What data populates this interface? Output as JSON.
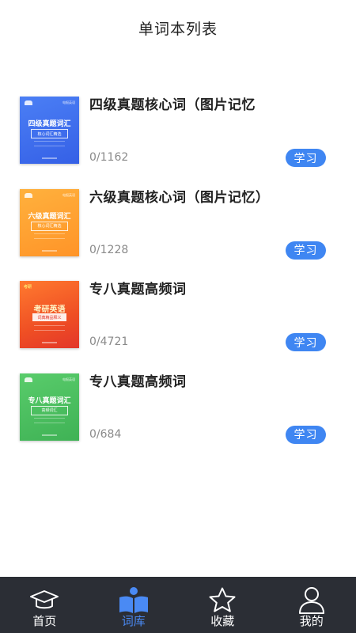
{
  "header": {
    "title": "单词本列表"
  },
  "books": [
    {
      "name": "四级真题核心词（图片记忆",
      "count": "0/1162",
      "action": "学习",
      "cover": {
        "theme": "blue",
        "brand": "电报英语",
        "title": "四级真题词汇",
        "subtitle": "核心词汇精选"
      }
    },
    {
      "name": "六级真题核心词（图片记忆）",
      "count": "0/1228",
      "action": "学习",
      "cover": {
        "theme": "orange",
        "brand": "电报英语",
        "title": "六级真题词汇",
        "subtitle": "核心词汇精选"
      }
    },
    {
      "name": "专八真题高频词",
      "count": "0/4721",
      "action": "学习",
      "cover": {
        "theme": "red",
        "brand": "考研",
        "title": "考研英语",
        "subtitle": "词典精品释义"
      }
    },
    {
      "name": "专八真题高频词",
      "count": "0/684",
      "action": "学习",
      "cover": {
        "theme": "green",
        "brand": "电报英语",
        "title": "专八真题词汇",
        "subtitle": "高频词汇"
      }
    }
  ],
  "tabs": [
    {
      "label": "首页",
      "icon": "graduation-cap-icon",
      "active": false
    },
    {
      "label": "词库",
      "icon": "open-book-icon",
      "active": true
    },
    {
      "label": "收藏",
      "icon": "star-icon",
      "active": false
    },
    {
      "label": "我的",
      "icon": "user-icon",
      "active": false
    }
  ],
  "colors": {
    "accent": "#3f86f2",
    "tab_active": "#4a8af4",
    "tabbar_bg": "#2b2e35",
    "count_text": "#8a8a8a"
  }
}
